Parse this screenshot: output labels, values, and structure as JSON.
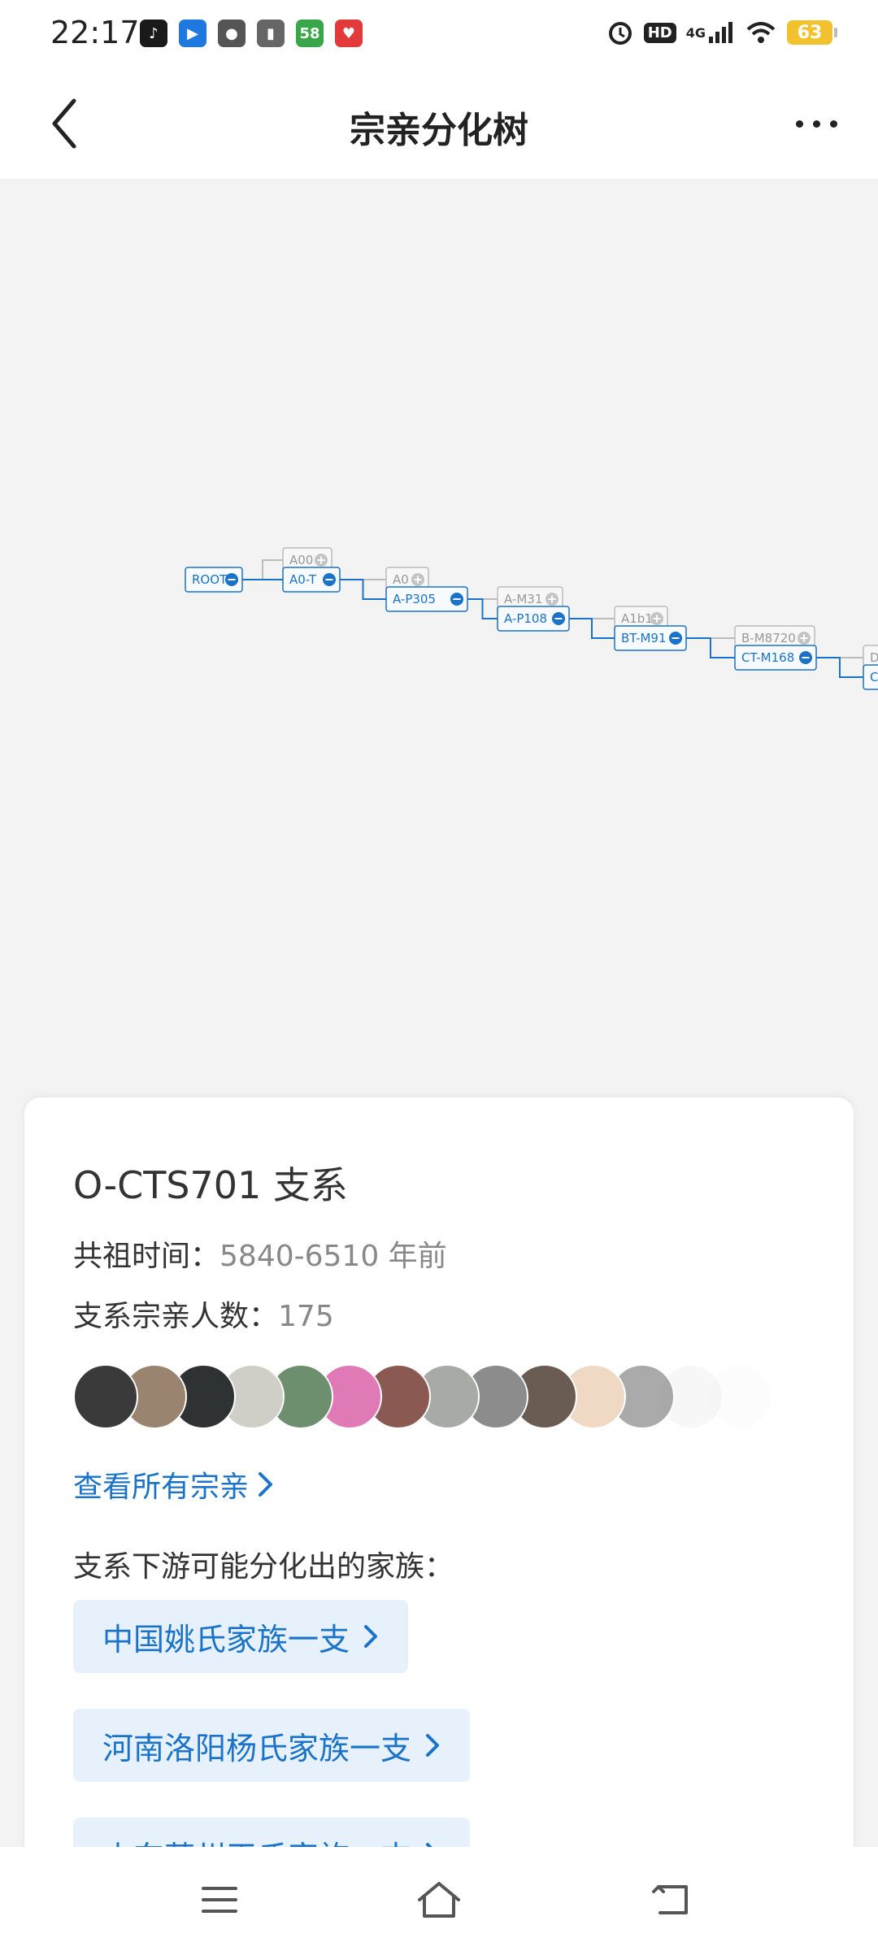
{
  "status_bar": {
    "time": "22:17",
    "apps": [
      {
        "icon": "tiktok-icon",
        "color": "#1a1a1a",
        "glyph": "♪"
      },
      {
        "icon": "bookmark-app-icon",
        "color": "#1e78e0",
        "glyph": "▶"
      },
      {
        "icon": "chat-bubble-icon",
        "color": "#555555",
        "glyph": "●"
      },
      {
        "icon": "battery-saver-icon",
        "color": "#666666",
        "glyph": "▮"
      },
      {
        "icon": "58-app-icon",
        "color": "#3aa64a",
        "glyph": "58"
      },
      {
        "icon": "heart-app-icon",
        "color": "#e23a3a",
        "glyph": "♥"
      }
    ],
    "battery": "63",
    "network": "4G",
    "hd_label": "HD"
  },
  "header": {
    "title": "宗亲分化树"
  },
  "tree": {
    "nodes": [
      {
        "label": "ROOT",
        "state": "expanded",
        "active": true
      },
      {
        "label": "A00",
        "state": "collapsed",
        "active": false
      },
      {
        "label": "A0-T",
        "state": "expanded",
        "active": true
      },
      {
        "label": "A0",
        "state": "collapsed",
        "active": false
      },
      {
        "label": "A-P305",
        "state": "expanded",
        "active": true
      },
      {
        "label": "A-M31",
        "state": "collapsed",
        "active": false
      },
      {
        "label": "A-P108",
        "state": "expanded",
        "active": true
      },
      {
        "label": "A1b1",
        "state": "collapsed",
        "active": false
      },
      {
        "label": "BT-M91",
        "state": "expanded",
        "active": true
      },
      {
        "label": "B-M8720",
        "state": "collapsed",
        "active": false
      },
      {
        "label": "CT-M168",
        "state": "expanded",
        "active": true
      },
      {
        "label": "D",
        "state": "collapsed",
        "active": false
      },
      {
        "label": "C",
        "state": "expanded",
        "active": true
      }
    ],
    "colors": {
      "active": "#1a73c9",
      "inactive": "#bbbbbb",
      "line": "#1a73c9",
      "line_inactive": "#bbbbbb"
    }
  },
  "card": {
    "title": "O-CTS701 支系",
    "time_label": "共祖时间：",
    "time_value": "5840-6510 年前",
    "count_label": "支系宗亲人数：",
    "count_value": "175",
    "avatar_colors": [
      "#3a3a3a",
      "#9a8470",
      "#2f3232",
      "#cfcfc8",
      "#6d8f6e",
      "#e07ab6",
      "#8a5a52",
      "#a8aaa6",
      "#8c8c8c",
      "#6a5c52",
      "#efd8c4",
      "#8e8e8e",
      "#f0f0f0",
      "#f7f7f7"
    ],
    "view_all": "查看所有宗亲",
    "downstream_label": "支系下游可能分化出的家族：",
    "families": [
      "中国姚氏家族一支",
      "河南洛阳杨氏家族一支",
      "山东莱州王氏家族一支"
    ]
  },
  "colors": {
    "accent": "#1a73c9",
    "chip_bg": "#e6f1fc"
  }
}
